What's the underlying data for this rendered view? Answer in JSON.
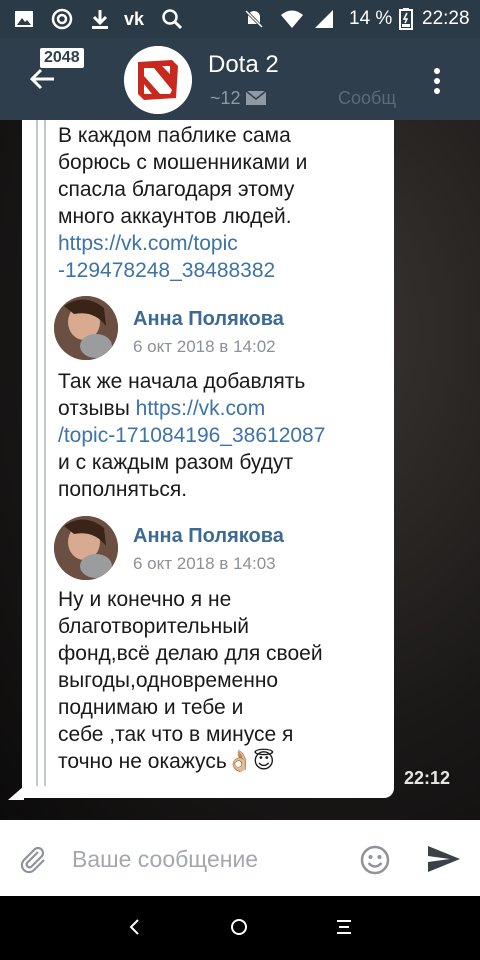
{
  "status_bar": {
    "battery_percent": "14 %",
    "time": "22:28",
    "icons": [
      "image-icon",
      "at-icon",
      "download-icon",
      "vk-icon",
      "search-icon",
      "mute-icon",
      "wifi-icon",
      "signal-icon",
      "battery-icon"
    ]
  },
  "header": {
    "badge": "2048",
    "title": "Dota 2",
    "subtitle_count": "~12",
    "subtitle_msg": "Сообщ"
  },
  "message": {
    "block1_lines": [
      "В каждом паблике сама",
      "борюсь с мошенниками и",
      "спасла благодаря этому",
      "много аккаунтов людей."
    ],
    "block1_link_lines": [
      "https://vk.com/topic",
      "-129478248_38488382"
    ],
    "author1_name": "Анна Полякова",
    "author1_date": "6 окт 2018 в 14:02",
    "block2_line1": "Так же начала добавлять",
    "block2_line2_text": "отзывы ",
    "block2_line2_link": "https://vk.com",
    "block2_line3_link": "/topic-171084196_38612087",
    "block2_lines_rest": [
      "и с каждым разом будут",
      "пополняться."
    ],
    "author2_name": "Анна Полякова",
    "author2_date": "6 окт 2018 в 14:03",
    "block3_lines": [
      "Ну и конечно я не",
      "благотворительный",
      "фонд,всё делаю для своей",
      "выгоды,одновременно",
      "поднимаю и тебе и",
      "себе ,так что в минусе я",
      "точно не окажусь"
    ],
    "block3_emoji": "👌🏼😇",
    "time": "22:12"
  },
  "composer": {
    "placeholder": "Ваше сообщение"
  },
  "colors": {
    "header_bg": "#2e3e4d",
    "status_bg": "#2b3a47",
    "link": "#3d73a6",
    "author": "#3d6a95"
  }
}
